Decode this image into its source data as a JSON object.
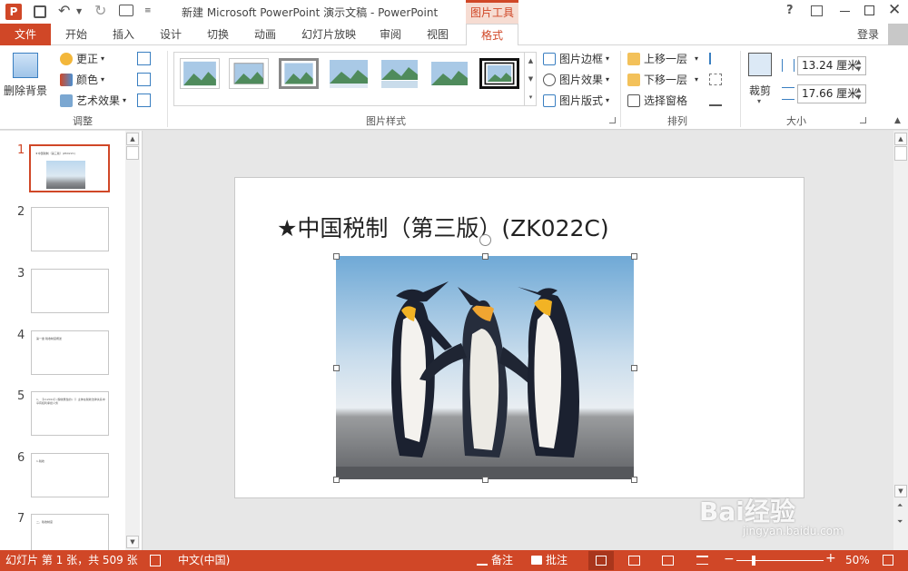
{
  "titlebar": {
    "app_icon": "P",
    "doc_title": "新建 Microsoft PowerPoint 演示文稿 - PowerPoint",
    "context_tab_group": "图片工具",
    "help": "?"
  },
  "tabs": {
    "file": "文件",
    "home": "开始",
    "insert": "插入",
    "design": "设计",
    "transitions": "切换",
    "animations": "动画",
    "slideshow": "幻灯片放映",
    "review": "审阅",
    "view": "视图",
    "format": "格式",
    "login": "登录"
  },
  "ribbon": {
    "remove_bg": "删除背景",
    "corrections": "更正",
    "color": "颜色",
    "artistic": "艺术效果",
    "adjust_group": "调整",
    "styles_group": "图片样式",
    "border": "图片边框",
    "effects": "图片效果",
    "layout": "图片版式",
    "bring_forward": "上移一层",
    "send_backward": "下移一层",
    "selection_pane": "选择窗格",
    "arrange_group": "排列",
    "crop": "裁剪",
    "height": "13.24 厘米",
    "width": "17.66 厘米",
    "size_group": "大小"
  },
  "slides": [
    {
      "num": "1",
      "text": "★中国税制（第三版）(ZK022C)"
    },
    {
      "num": "2",
      "text": ""
    },
    {
      "num": "3",
      "text": ""
    },
    {
      "num": "4",
      "text": "第一章 税收制度概述"
    },
    {
      "num": "5",
      "text": "1、【112012】(税收属性的)（）主体在税收法律关系中享有权利承担义务"
    },
    {
      "num": "6",
      "text": "1.税收"
    },
    {
      "num": "7",
      "text": "二、税收制度"
    }
  ],
  "slide": {
    "title": "★中国税制（第三版）(ZK022C)"
  },
  "status": {
    "slide_info": "幻灯片 第 1 张，共 509 张",
    "language": "中文(中国)",
    "notes": "备注",
    "comments": "批注",
    "zoom": "50%"
  },
  "watermark": {
    "brand": "Bai经验",
    "url": "jingyan.baidu.com"
  },
  "colors": {
    "accent": "#d04727",
    "context_tab": "#d04727",
    "ribbon_bg": "#ffffff",
    "pane_bg": "#e7e7e7"
  }
}
